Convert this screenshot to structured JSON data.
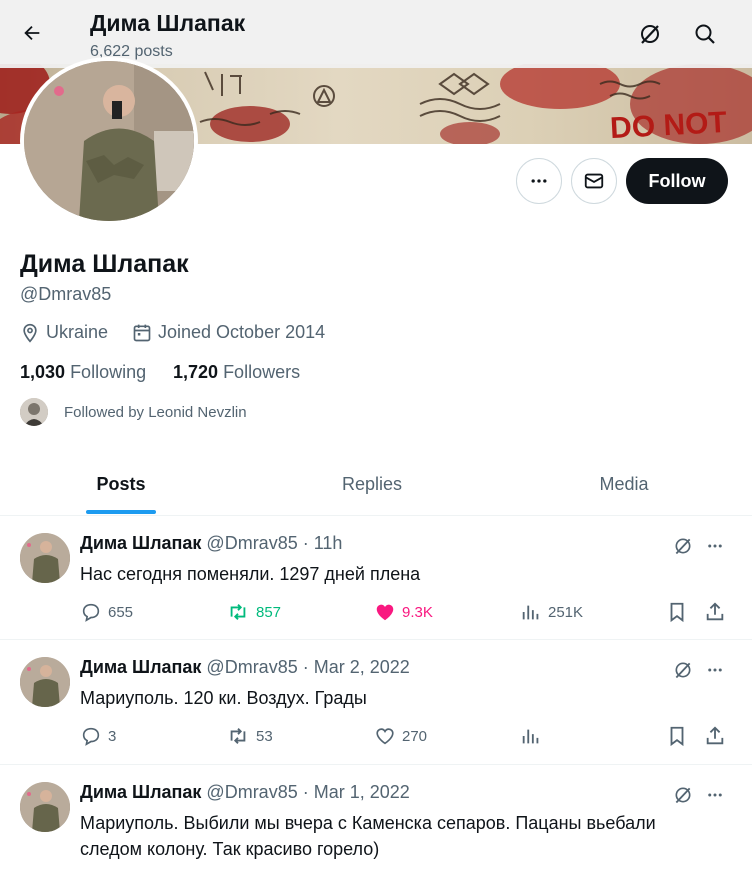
{
  "header": {
    "name": "Дима Шлапак",
    "posts_count": "6,622 posts"
  },
  "banner": {
    "text": "DO NOT"
  },
  "profile": {
    "name": "Дима Шлапак",
    "handle": "@Dmrav85",
    "location": "Ukraine",
    "joined": "Joined October 2014",
    "following_count": "1,030",
    "following_label": "Following",
    "followers_count": "1,720",
    "followers_label": "Followers",
    "followed_by": "Followed by Leonid Nevzlin",
    "follow_button": "Follow"
  },
  "tabs": [
    {
      "label": "Posts",
      "active": true
    },
    {
      "label": "Replies",
      "active": false
    },
    {
      "label": "Media",
      "active": false
    }
  ],
  "posts": [
    {
      "name": "Дима Шлапак",
      "meta": "@Dmrav85 · 11h",
      "lines": [
        "Нас сегодня поменяли. 1297 дней плена"
      ],
      "replies": "655",
      "reposts": "857",
      "likes": "9.3K",
      "views": "251K",
      "reposted": true,
      "liked": true
    },
    {
      "name": "Дима Шлапак",
      "meta": "@Dmrav85 · Mar 2, 2022",
      "lines": [
        "Мариуполь. 120 ки. Воздух. Грады"
      ],
      "replies": "3",
      "reposts": "53",
      "likes": "270",
      "views": "",
      "reposted": false,
      "liked": false
    },
    {
      "name": "Дима Шлапак",
      "meta": "@Dmrav85 · Mar 1, 2022",
      "lines": [
        "Мариуполь. Выбили мы вчера с Каменска сепаров. Пацаны вьебали",
        "следом колону. Так красиво горело)"
      ]
    }
  ],
  "colors": {
    "accent": "#1d9bf0",
    "repost_active": "#00ba7c",
    "like_active": "#f91880",
    "muted": "#536471",
    "text": "#0f1419"
  }
}
